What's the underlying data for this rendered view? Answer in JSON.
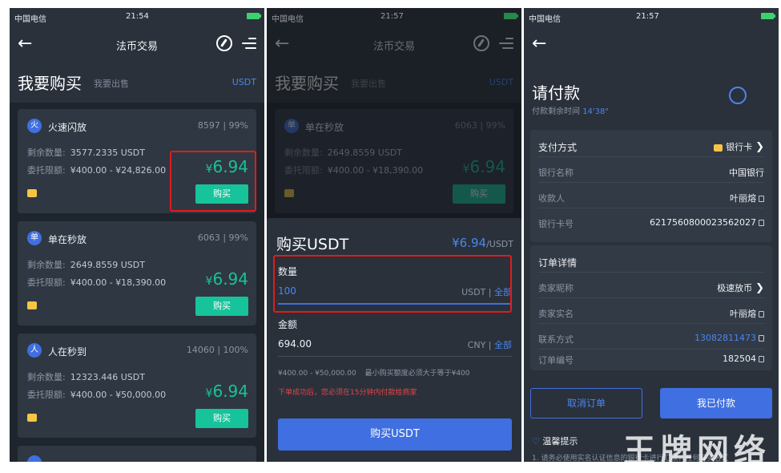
{
  "status": {
    "carrier": "中国电信",
    "time1": "21:54",
    "time2": "21:57",
    "time3": "21:57"
  },
  "nav": {
    "title": "法币交易"
  },
  "tabs": {
    "buy": "我要购买",
    "sell": "我要出售",
    "coin": "USDT"
  },
  "labels": {
    "remaining": "剩余数量:",
    "limit": "委托限额:",
    "buy_button": "购买",
    "currency": "¥"
  },
  "merchants": [
    {
      "avatar": "火",
      "name": "火速闪放",
      "stat": "8597 | 99%",
      "remaining": "3577.2335 USDT",
      "limit": "¥400.00 - ¥24,826.00",
      "price": "6.94"
    },
    {
      "avatar": "单",
      "name": "单在秒放",
      "stat": "6063 | 99%",
      "remaining": "2649.8559 USDT",
      "limit": "¥400.00 - ¥18,390.00",
      "price": "6.94"
    },
    {
      "avatar": "人",
      "name": "人在秒到",
      "stat": "14060 | 100%",
      "remaining": "12323.446 USDT",
      "limit": "¥400.00 - ¥50,000.00",
      "price": "6.94"
    }
  ],
  "order_sheet": {
    "title": "购买USDT",
    "price": "¥6.94",
    "price_unit": "/USDT",
    "qty_label": "数量",
    "qty_value": "100",
    "qty_unit": "USDT |",
    "all_label": "全部",
    "amount_label": "金额",
    "amount_value": "694.00",
    "amount_unit": "CNY |",
    "limits": "¥400.00 - ¥50,000.00",
    "min_note": "最小购买额度必须大于等于¥400",
    "warning": "下单成功后，您必须在15分钟内付款给商家",
    "submit": "购买USDT"
  },
  "payment": {
    "title": "请付款",
    "time_label": "付款剩余时间",
    "time_value": "14'38\"",
    "method_label": "支付方式",
    "method_value": "银行卡",
    "bank_name_label": "银行名称",
    "bank_name": "中国银行",
    "payee_label": "收款人",
    "payee": "叶丽熔",
    "card_label": "银行卡号",
    "card_no": "6217560800023562027",
    "details_label": "订单详情",
    "seller_nick_label": "卖家昵称",
    "seller_nick": "极速放币",
    "seller_name_label": "卖家实名",
    "seller_name": "叶丽熔",
    "contact_label": "联系方式",
    "contact": "13082811473",
    "order_no_label": "订单编号",
    "order_no": "182504",
    "cancel": "取消订单",
    "paid": "我已付款",
    "tips": "温馨提示",
    "tip_note": "1. 请务必使用实名认证信息的银行卡进行汇款，任何非实名汇"
  },
  "watermark": "王牌网络"
}
